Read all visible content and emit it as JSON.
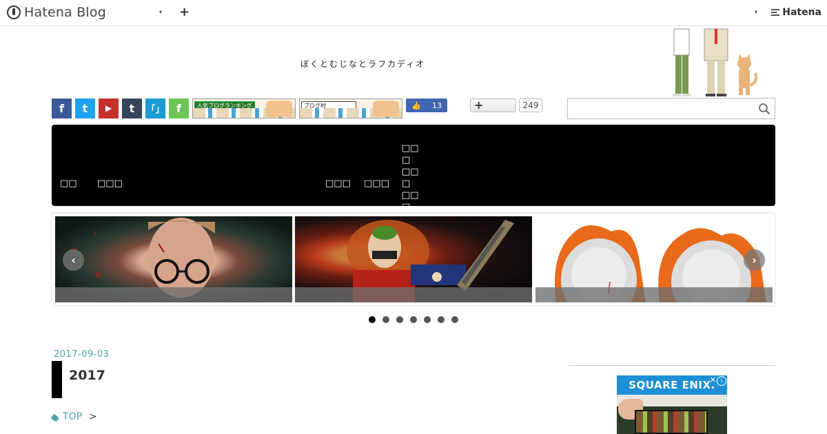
{
  "topbar": {
    "logo_text": "Hatena Blog",
    "caret": "▾",
    "plus": "+",
    "brand": "Hatena"
  },
  "blog": {
    "title": "ぼくとむじなとラフカディオ"
  },
  "share": {
    "facebook": "f",
    "twitter": "t",
    "youtube": "▶",
    "tumblr": "t",
    "hatena": "「」",
    "feedly": "f",
    "banner1_text": "人気ブログランキング",
    "banner2_text": "ブログ村",
    "fb_like_count": "13",
    "hatena_bookmark_plus": "+",
    "hatena_bookmark_count": "249"
  },
  "search": {
    "value": "",
    "placeholder": ""
  },
  "nav": {
    "items": [
      {
        "label": "□□"
      },
      {
        "label": "□□□"
      },
      {
        "label": "□□□"
      },
      {
        "label": "□□□"
      },
      {
        "label": "□□□ □□□ □□□ □□□"
      }
    ]
  },
  "carousel": {
    "prev": "‹",
    "next": "›",
    "dot_count": 7,
    "active_index": 0
  },
  "entry": {
    "date": "2017-09-03",
    "title": "2017",
    "breadcrumb_top": "TOP",
    "breadcrumb_sep": ">"
  },
  "ad": {
    "brand": "SQUARE ENIX.",
    "info": "i",
    "close": "✕"
  },
  "colors": {
    "accent": "#4aa6a0",
    "nav_bg": "#000000",
    "facebook": "#3b5998",
    "twitter": "#1da1f2",
    "youtube": "#c4302b",
    "tumblr": "#35465c",
    "hatena": "#1a9bd1",
    "feedly": "#6cc655"
  }
}
